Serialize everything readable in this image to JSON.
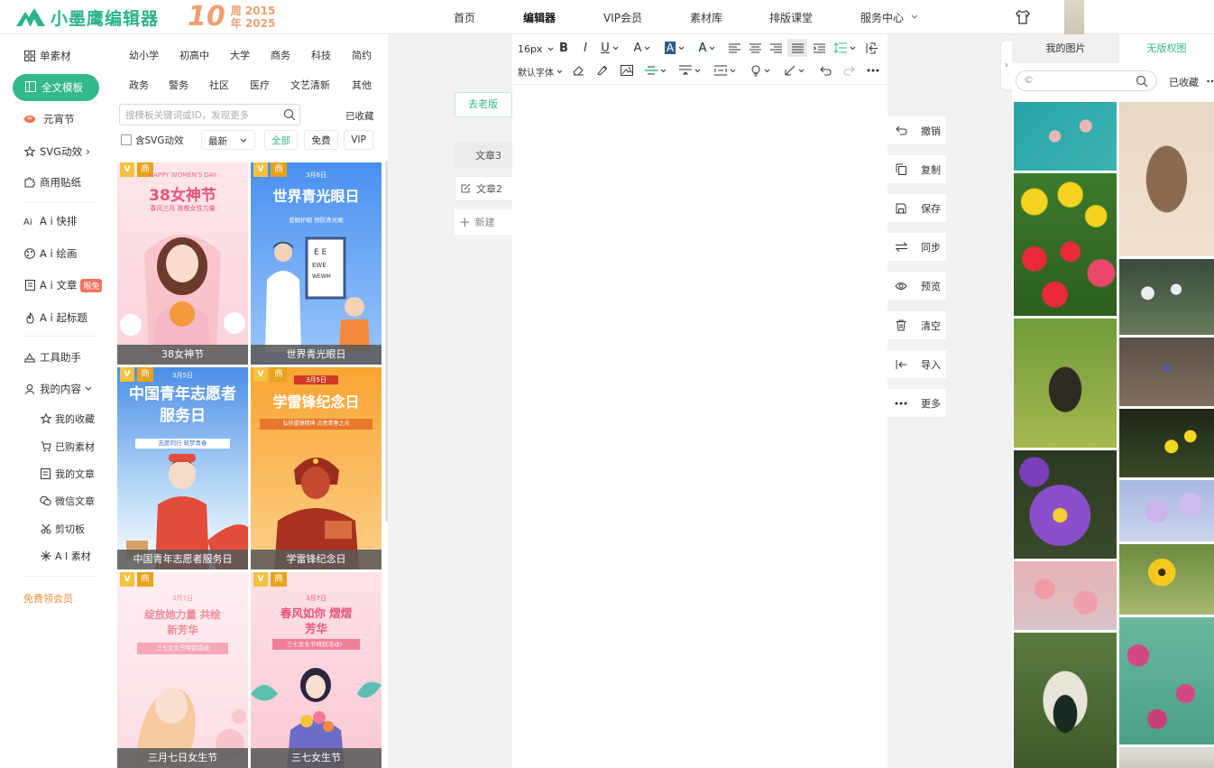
{
  "topbar": {
    "brand": "小墨鹰编辑器",
    "anniversary": {
      "number": "10",
      "line1": "周 2015",
      "line2": "年 2025"
    },
    "nav": [
      "首页",
      "编辑器",
      "VIP会员",
      "素材库",
      "排版课堂",
      "服务中心"
    ],
    "active_nav": "编辑器"
  },
  "sidebar": {
    "items": [
      {
        "label": "单素材",
        "icon": "grid-icon"
      },
      {
        "label": "全文模板",
        "icon": "layout-icon",
        "active": true
      },
      {
        "label": "元宵节",
        "icon": "lantern-icon"
      },
      {
        "label": "SVG动效",
        "icon": "star-icon"
      },
      {
        "label": "商用贴纸",
        "icon": "puzzle-icon"
      },
      {
        "label": "A i 快排",
        "icon": "ai-icon"
      },
      {
        "label": "A i 绘画",
        "icon": "palette-icon"
      },
      {
        "label": "A i 文章",
        "icon": "doc-icon",
        "badge": "限免"
      },
      {
        "label": "A i 起标题",
        "icon": "fire-icon"
      },
      {
        "label": "工具助手",
        "icon": "tools-icon"
      },
      {
        "label": "我的内容",
        "icon": "user-icon"
      }
    ],
    "sub_items": [
      {
        "label": "我的收藏",
        "icon": "star-icon"
      },
      {
        "label": "已购素材",
        "icon": "cart-icon"
      },
      {
        "label": "我的文章",
        "icon": "doc-icon"
      },
      {
        "label": "微信文章",
        "icon": "wechat-icon"
      },
      {
        "label": "剪切板",
        "icon": "scissors-icon"
      },
      {
        "label": "A I 素材",
        "icon": "sparkle-icon"
      }
    ],
    "free_vip": "免费领会员",
    "accent": "#34b88e"
  },
  "templates": {
    "categories_row1": [
      "幼小学",
      "初高中",
      "大学",
      "商务",
      "科技",
      "简约"
    ],
    "categories_row2": [
      "政务",
      "警务",
      "社区",
      "医疗",
      "文艺清新",
      "其他"
    ],
    "search_placeholder": "搜模板关键词或ID，发现更多",
    "favorites": "已收藏",
    "svg_checkbox": "含SVG动效",
    "sort": "最新",
    "filters": [
      "全部",
      "免费",
      "VIP"
    ],
    "active_filter": "全部",
    "cards": [
      {
        "caption": "38女神节",
        "title": "38女神节",
        "top": "HAPPY WOMEN'S DAY",
        "sub": "春风三月 致敬女性力量",
        "vip": "V",
        "tag": "商"
      },
      {
        "caption": "世界青光眼日",
        "title": "世界青光眼日",
        "top": "3月6日",
        "sub": "爱眼护眼 预防青光眼",
        "vip": "V",
        "tag": "商"
      },
      {
        "caption": "中国青年志愿者服务日",
        "title": "中国青年志愿者服务日",
        "top": "3月5日",
        "sub": "志愿同行 筑梦青春",
        "vip": "V",
        "tag": "商"
      },
      {
        "caption": "学雷锋纪念日",
        "title": "学雷锋纪念日",
        "top": "3月5日",
        "sub": "弘扬雷锋精神 点亮青春之光",
        "vip": "V",
        "tag": "商"
      },
      {
        "caption": "三月七日女生节",
        "title": "绽放她力量 共绘新芳华",
        "top": "3月7日",
        "sub": "三七女生节特别活动",
        "vip": "V",
        "tag": "商"
      },
      {
        "caption": "三七女生节",
        "title": "春风如你 熠熠芳华",
        "top": "3月7日",
        "sub": "三七女生节特别活动！",
        "vip": "V",
        "tag": "商"
      }
    ]
  },
  "editor": {
    "old_version": "去老版",
    "docs": [
      "文章3",
      "文章2"
    ],
    "new_doc": "新建",
    "toolbar": {
      "font_size": "16px",
      "font_family": "默认字体"
    }
  },
  "actions": [
    "撤销",
    "复制",
    "保存",
    "同步",
    "预览",
    "清空",
    "导入",
    "更多"
  ],
  "right_panel": {
    "tabs": [
      "我的图片",
      "无版权图"
    ],
    "active_tab": "无版权图",
    "search_placeholder": "©",
    "favorites": "已收藏"
  }
}
